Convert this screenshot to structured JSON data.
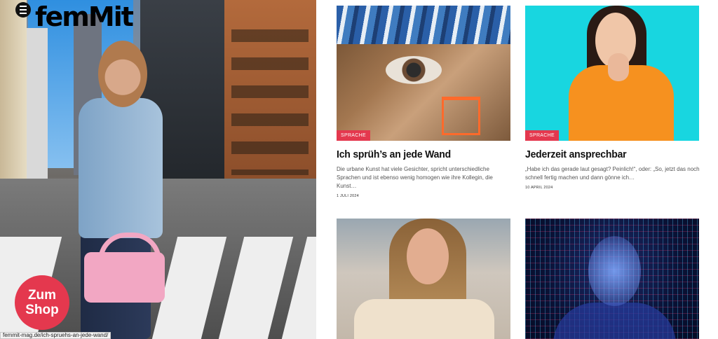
{
  "header": {
    "logo_text": "femMit",
    "menu_icon": "hamburger-menu-icon"
  },
  "hero": {
    "shop_badge_label": "Zum Shop"
  },
  "statusbar": {
    "url": "femmit-mag.de/ich-spruehs-an-jede-wand/"
  },
  "cards": [
    {
      "tag": "SPRACHE",
      "title": "Ich sprüh’s an jede Wand",
      "excerpt": "Die urbane Kunst hat viele Gesichter, spricht unterschiedliche Sprachen und ist ebenso wenig homogen wie ihre Kollegin, die Kunst…",
      "date": "1 JULI 2024"
    },
    {
      "tag": "SPRACHE",
      "title": "Jederzeit ansprechbar",
      "excerpt": "„Habe ich das gerade laut gesagt? Peinlich!“, oder: „So, jetzt das noch schnell fertig machen und dann gönne ich…",
      "date": "10 APRIL 2024"
    },
    {},
    {}
  ],
  "colors": {
    "accent": "#e4384e",
    "text": "#111111",
    "muted": "#555555"
  }
}
